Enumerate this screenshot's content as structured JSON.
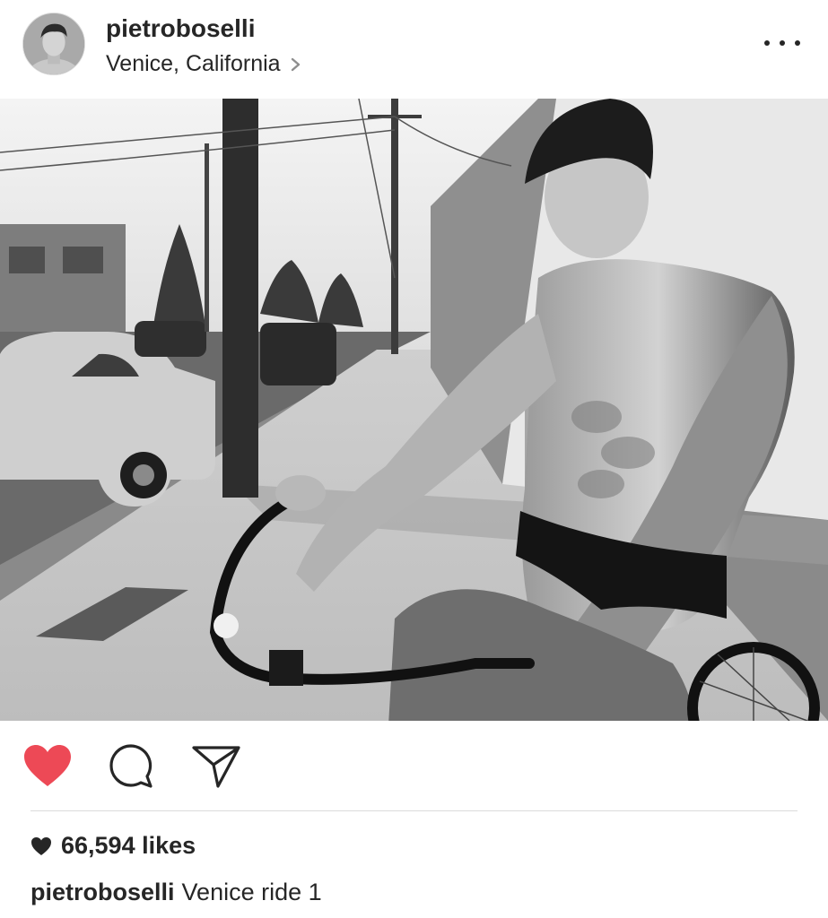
{
  "post": {
    "username": "pietroboselli",
    "location": "Venice, California",
    "likes_text": "66,594 likes",
    "caption_username": "pietroboselli",
    "caption_text": "Venice ride 1",
    "liked": true
  },
  "icons": {
    "more": "more-options-icon",
    "chevron": "chevron-right-icon",
    "like": "heart-icon",
    "comment": "comment-icon",
    "share": "share-icon",
    "likes_heart": "heart-icon"
  },
  "colors": {
    "liked_heart": "#ed4956",
    "text": "#262626",
    "divider": "#dbdbdb"
  }
}
